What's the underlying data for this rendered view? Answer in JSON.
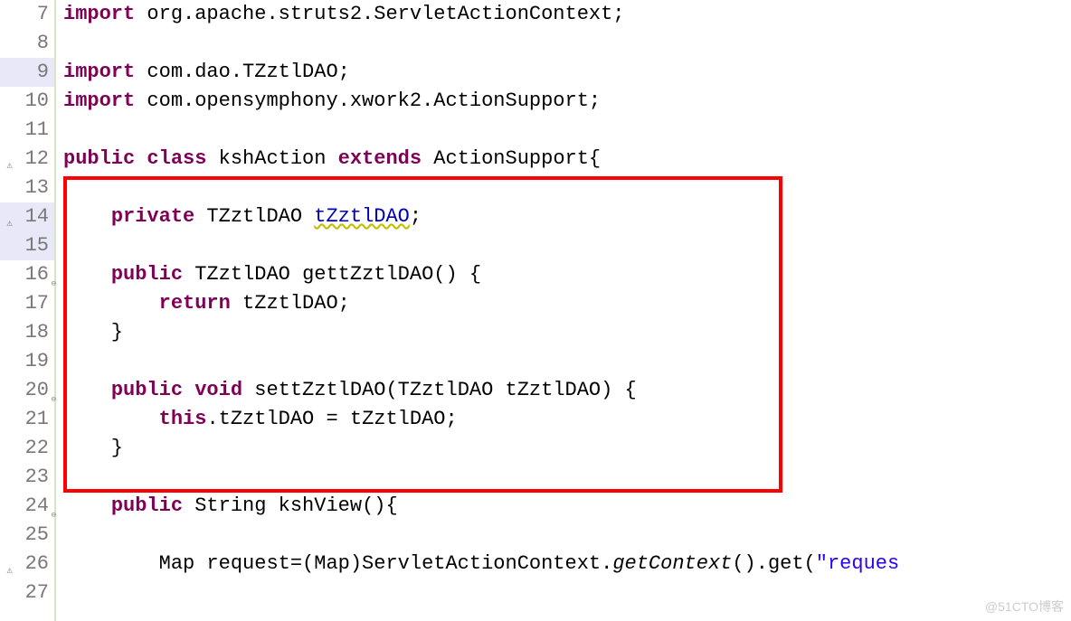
{
  "gutter": {
    "lines": [
      {
        "num": "7",
        "highlighted": false,
        "marker": "",
        "foldable": ""
      },
      {
        "num": "8",
        "highlighted": false,
        "marker": "",
        "foldable": ""
      },
      {
        "num": "9",
        "highlighted": true,
        "marker": "",
        "foldable": ""
      },
      {
        "num": "10",
        "highlighted": false,
        "marker": "",
        "foldable": ""
      },
      {
        "num": "11",
        "highlighted": false,
        "marker": "",
        "foldable": ""
      },
      {
        "num": "12",
        "highlighted": false,
        "marker": "⚠",
        "foldable": ""
      },
      {
        "num": "13",
        "highlighted": false,
        "marker": "",
        "foldable": ""
      },
      {
        "num": "14",
        "highlighted": true,
        "marker": "⚠",
        "foldable": ""
      },
      {
        "num": "15",
        "highlighted": true,
        "marker": "",
        "foldable": ""
      },
      {
        "num": "16",
        "highlighted": false,
        "marker": "",
        "foldable": "⊖"
      },
      {
        "num": "17",
        "highlighted": false,
        "marker": "",
        "foldable": ""
      },
      {
        "num": "18",
        "highlighted": false,
        "marker": "",
        "foldable": ""
      },
      {
        "num": "19",
        "highlighted": false,
        "marker": "",
        "foldable": ""
      },
      {
        "num": "20",
        "highlighted": false,
        "marker": "",
        "foldable": "⊖"
      },
      {
        "num": "21",
        "highlighted": false,
        "marker": "",
        "foldable": ""
      },
      {
        "num": "22",
        "highlighted": false,
        "marker": "",
        "foldable": ""
      },
      {
        "num": "23",
        "highlighted": false,
        "marker": "",
        "foldable": ""
      },
      {
        "num": "24",
        "highlighted": false,
        "marker": "",
        "foldable": "⊖"
      },
      {
        "num": "25",
        "highlighted": false,
        "marker": "",
        "foldable": ""
      },
      {
        "num": "26",
        "highlighted": false,
        "marker": "⚠",
        "foldable": ""
      },
      {
        "num": "27",
        "highlighted": false,
        "marker": "",
        "foldable": ""
      }
    ]
  },
  "code": {
    "l7": {
      "kw1": "import",
      "rest": " org.apache.struts2.ServletActionContext;"
    },
    "l8": {
      "rest": ""
    },
    "l9": {
      "kw1": "import",
      "rest": " com.dao.TZztlDAO;"
    },
    "l10": {
      "kw1": "import",
      "rest": " com.opensymphony.xwork2.ActionSupport;"
    },
    "l11": {
      "rest": ""
    },
    "l12": {
      "kw1": "public",
      "kw2": "class",
      "name": " kshAction ",
      "kw3": "extends",
      "rest": " ActionSupport{"
    },
    "l13": {
      "rest": ""
    },
    "l14": {
      "indent": "    ",
      "kw1": "private",
      "type": " TZztlDAO ",
      "field": "tZztlDAO",
      "rest": ";"
    },
    "l15": {
      "rest": "    "
    },
    "l16": {
      "indent": "    ",
      "kw1": "public",
      "type": " TZztlDAO ",
      "method": "gettZztlDAO",
      "rest": "() {"
    },
    "l17": {
      "indent": "        ",
      "kw1": "return",
      "rest": " tZztlDAO;"
    },
    "l18": {
      "rest": "    }"
    },
    "l19": {
      "rest": ""
    },
    "l20": {
      "indent": "    ",
      "kw1": "public",
      "kw2": "void",
      "method": " settZztlDAO",
      "rest": "(TZztlDAO tZztlDAO) {"
    },
    "l21": {
      "indent": "        ",
      "kw1": "this",
      "rest": ".tZztlDAO = tZztlDAO;"
    },
    "l22": {
      "rest": "    }"
    },
    "l23": {
      "rest": ""
    },
    "l24": {
      "indent": "    ",
      "kw1": "public",
      "type": " String ",
      "method": "kshView",
      "rest": "(){"
    },
    "l25": {
      "rest": ""
    },
    "l26": {
      "indent": "        ",
      "pre": "Map request=(Map)ServletActionContext.",
      "method": "getContext",
      "mid": "().get(",
      "str": "\"reques"
    },
    "l27": {
      "rest": ""
    }
  },
  "watermark": "@51CTO博客"
}
